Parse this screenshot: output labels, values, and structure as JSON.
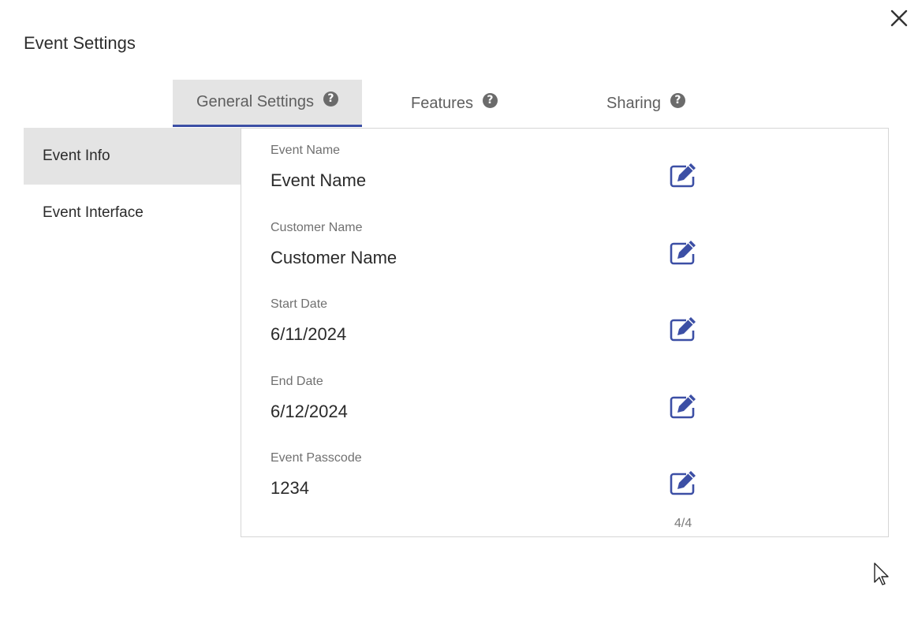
{
  "dialog": {
    "title": "Event Settings"
  },
  "tabs": [
    {
      "label": "General Settings",
      "active": true,
      "help_icon": "question-circle-icon"
    },
    {
      "label": "Features",
      "active": false,
      "help_icon": "question-circle-icon"
    },
    {
      "label": "Sharing",
      "active": false,
      "help_icon": "question-circle-icon"
    }
  ],
  "sidebar": {
    "items": [
      {
        "label": "Event Info",
        "active": true
      },
      {
        "label": "Event Interface",
        "active": false
      }
    ]
  },
  "fields": [
    {
      "label": "Event Name",
      "value": "Event Name"
    },
    {
      "label": "Customer Name",
      "value": "Customer Name"
    },
    {
      "label": "Start Date",
      "value": "6/11/2024"
    },
    {
      "label": "End Date",
      "value": "6/12/2024"
    },
    {
      "label": "Event Passcode",
      "value": "1234"
    }
  ],
  "pagination": {
    "text": "4/4"
  },
  "colors": {
    "accent": "#3c4fa5",
    "active_bg": "#e4e4e4",
    "edit_icon": "#3c4fa5"
  }
}
